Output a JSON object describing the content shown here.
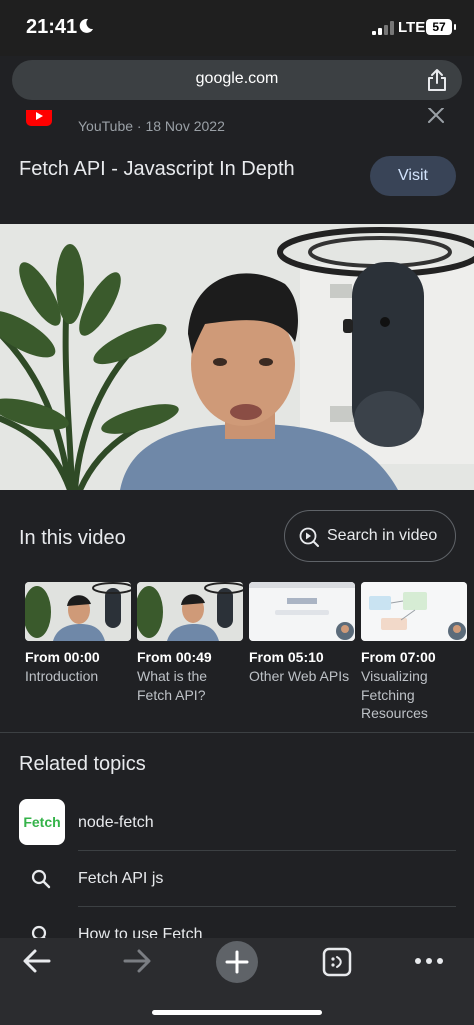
{
  "status_bar": {
    "time": "21:41",
    "network": "LTE",
    "battery": "57"
  },
  "address_bar": {
    "url": "google.com"
  },
  "result": {
    "source": "YouTube · 18 Nov 2022",
    "title": "Fetch API - Javascript In Depth",
    "visit_label": "Visit"
  },
  "in_this_video": {
    "heading": "In this video",
    "search_label": "Search in video",
    "chapters": [
      {
        "time": "From 00:00",
        "name": "Introduction"
      },
      {
        "time": "From 00:49",
        "name": "What is the Fetch API?"
      },
      {
        "time": "From 05:10",
        "name": "Other Web APIs"
      },
      {
        "time": "From 07:00",
        "name": "Visualizing Fetching Resources"
      }
    ]
  },
  "related_topics": {
    "heading": "Related topics",
    "logo_text": "Fetch",
    "items": [
      {
        "label": "node-fetch",
        "icon": "fetch-logo"
      },
      {
        "label": "Fetch API js",
        "icon": "search-icon"
      },
      {
        "label": "How to use Fetch",
        "icon": "search-icon"
      }
    ]
  },
  "colors": {
    "background": "#202124",
    "visit_button": "#394457",
    "logo_green": "#35b34a"
  }
}
